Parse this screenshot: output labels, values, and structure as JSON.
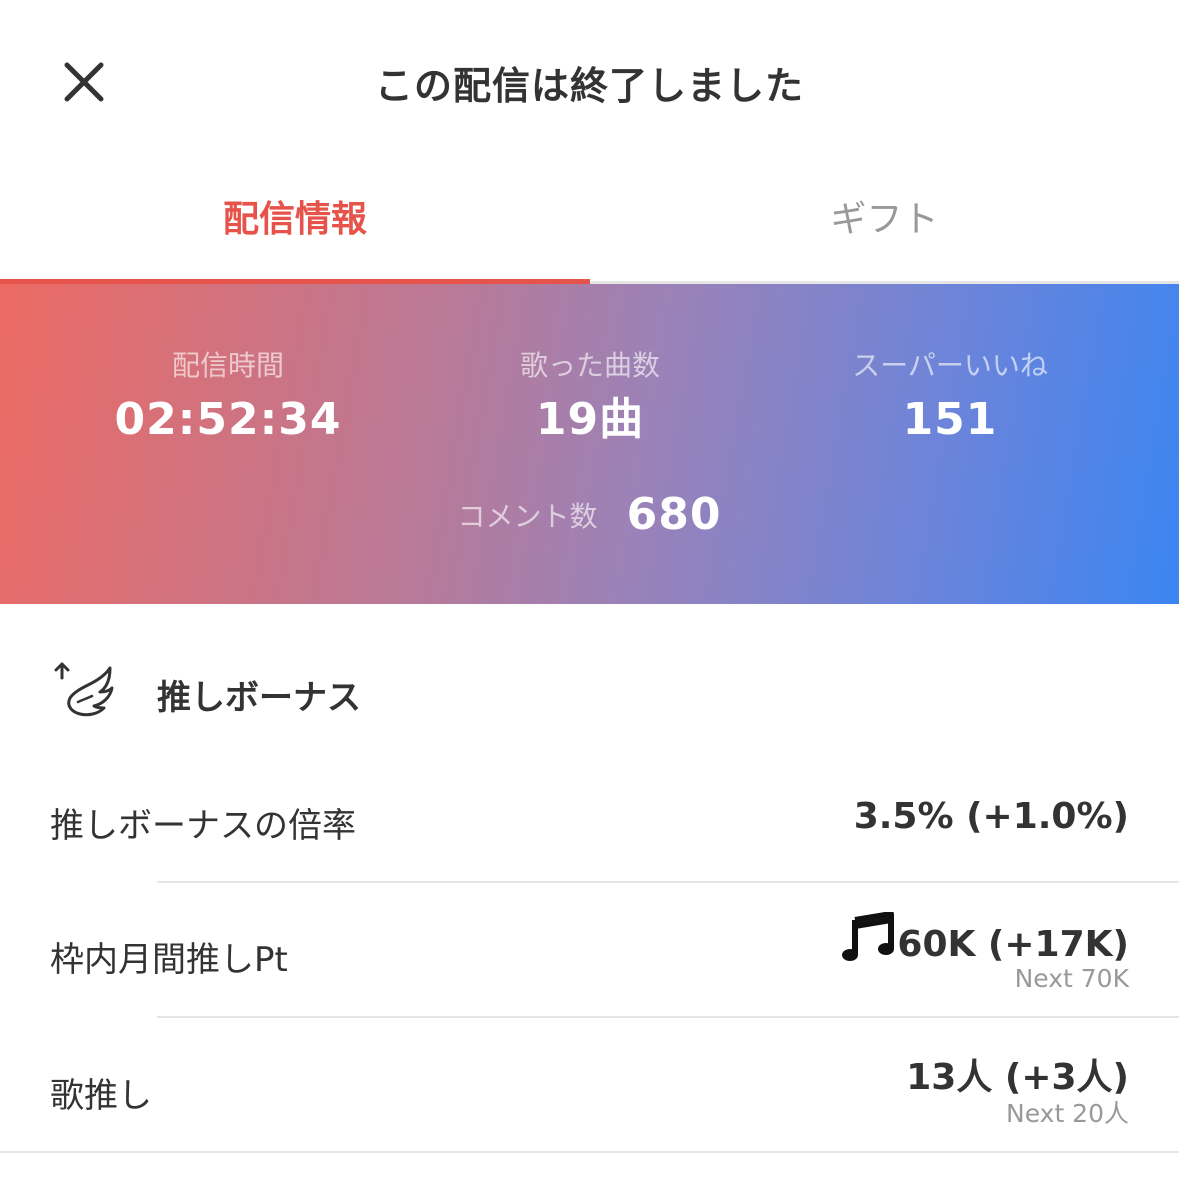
{
  "header": {
    "title": "この配信は終了しました",
    "close_icon": "close-icon"
  },
  "tabs": [
    {
      "label": "配信情報",
      "active": true
    },
    {
      "label": "ギフト",
      "active": false
    }
  ],
  "colors": {
    "accent": "#e5534b",
    "gradient_start": "#ec6a63",
    "gradient_end": "#3b85f2"
  },
  "stats": {
    "duration": {
      "label": "配信時間",
      "value": "02:52:34"
    },
    "songs": {
      "label": "歌った曲数",
      "value": "19曲"
    },
    "super_likes": {
      "label": "スーパーいいね",
      "value": "151"
    },
    "comments": {
      "label": "コメント数",
      "value": "680"
    }
  },
  "bonus_section": {
    "icon": "wing-icon",
    "title": "推しボーナス",
    "rows": [
      {
        "label": "推しボーナスの倍率",
        "value": "3.5% (+1.0%)"
      },
      {
        "label": "枠内月間推しPt",
        "icon": "music-note-icon",
        "value": "60K (+17K)",
        "next": "Next 70K"
      },
      {
        "label": "歌推し",
        "value": "13人 (+3人)",
        "next": "Next 20人"
      }
    ]
  }
}
